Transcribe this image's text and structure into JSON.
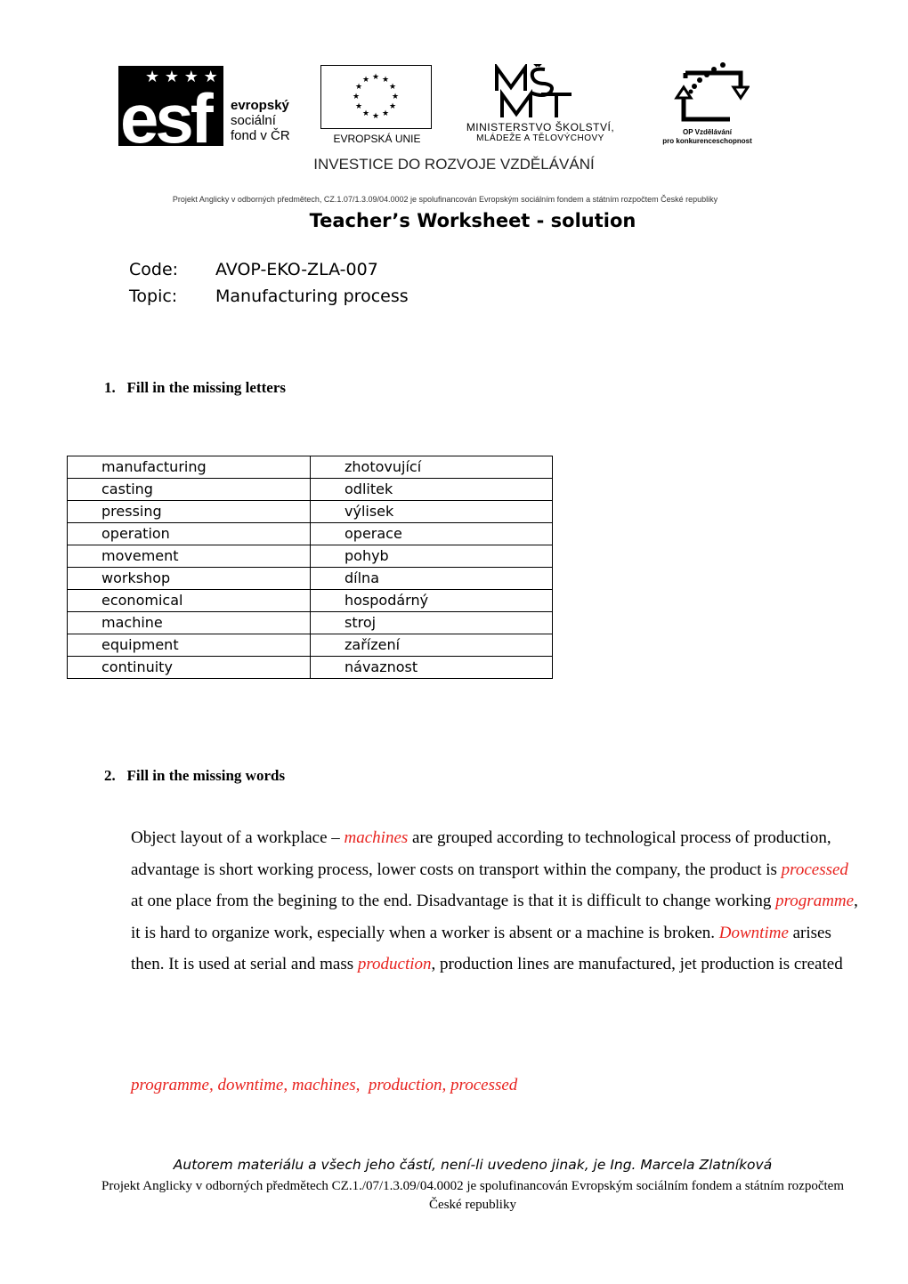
{
  "header": {
    "logos": {
      "esf": {
        "mark": "esf",
        "lines": [
          "evropský",
          "sociální",
          "fond v ČR"
        ]
      },
      "eu": {
        "label": "EVROPSKÁ UNIE"
      },
      "msmt": {
        "mark": "MŠMT",
        "line1": "MINISTERSTVO ŠKOLSTVÍ,",
        "line2": "MLÁDEŽE A TĚLOVÝCHOVY"
      },
      "op": {
        "line1": "OP Vzdělávání",
        "line2": "pro konkurenceschopnost"
      }
    },
    "slogan": "INVESTICE DO ROZVOJE VZDĚLÁVÁNÍ",
    "project_note": "Projekt Anglicky v odborných předmětech, CZ.1.07/1.3.09/04.0002 je spolufinancován Evropským sociálním fondem a státním rozpočtem České republiky"
  },
  "document": {
    "title": "Teacher’s Worksheet - solution",
    "meta": [
      {
        "label": "Code:",
        "value": "AVOP-EKO-ZLA-007"
      },
      {
        "label": "Topic:",
        "value": "Manufacturing process"
      }
    ]
  },
  "exercise1": {
    "heading": "1.   Fill in the missing letters",
    "rows": [
      [
        "manufacturing",
        "zhotovující"
      ],
      [
        "casting",
        "odlitek"
      ],
      [
        "pressing",
        "výlisek"
      ],
      [
        "operation",
        "operace"
      ],
      [
        "movement",
        "pohyb"
      ],
      [
        "workshop",
        "dílna"
      ],
      [
        "economical",
        "hospodárný"
      ],
      [
        "machine",
        "stroj"
      ],
      [
        "equipment",
        "zařízení"
      ],
      [
        "continuity",
        "návaznost"
      ]
    ]
  },
  "exercise2": {
    "heading": "2.   Fill in the missing words",
    "segments": [
      {
        "text": "Object layout of a workplace – ",
        "answer": false
      },
      {
        "text": "machines",
        "answer": true
      },
      {
        "text": " are grouped according to technological process of production, advantage is short working process, lower costs on transport within the company, the product is ",
        "answer": false
      },
      {
        "text": "processed",
        "answer": true
      },
      {
        "text": " at one place from the begining to the end. Disadvantage is that it is difficult to change working ",
        "answer": false
      },
      {
        "text": "programme",
        "answer": true
      },
      {
        "text": ", it is hard to organize work, especially when a worker is absent or a machine is broken. ",
        "answer": false
      },
      {
        "text": "Downtime",
        "answer": true
      },
      {
        "text": " arises then. It is used at serial and mass ",
        "answer": false
      },
      {
        "text": "production",
        "answer": true
      },
      {
        "text": ", production lines are manufactured, jet production is created",
        "answer": false
      }
    ],
    "word_bank": "programme, downtime, machines,  production, processed",
    "answer_color": "#e8231f"
  },
  "footer": {
    "author": "Autorem materiálu a všech jeho částí, není-li uvedeno jinak, je Ing. Marcela Zlatníková",
    "project": "Projekt Anglicky v odborných předmětech CZ.1./07/1.3.09/04.0002 je spolufinancován Evropským sociálním fondem a státním rozpočtem České republiky"
  }
}
